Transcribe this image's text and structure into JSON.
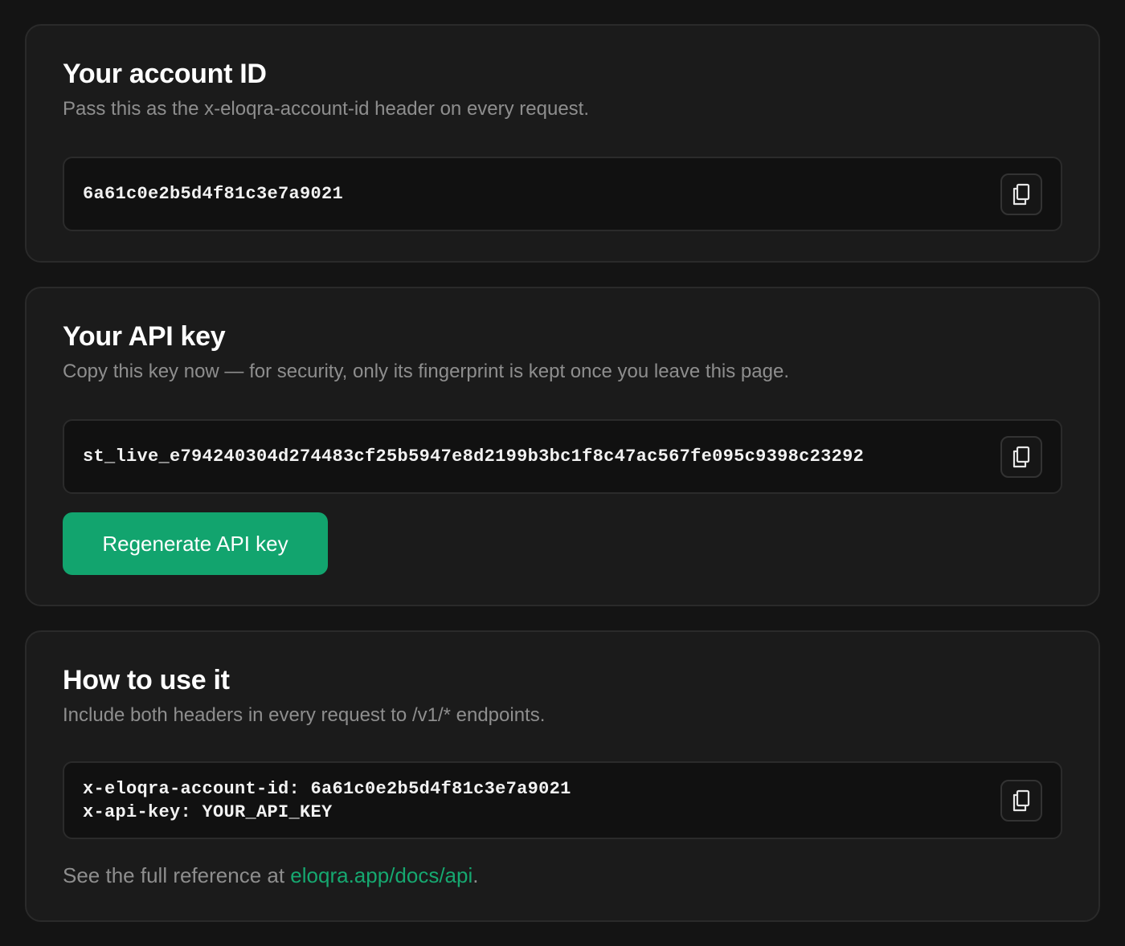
{
  "account_card": {
    "title": "Your account ID",
    "description": "Pass this as the x-eloqra-account-id header on every request.",
    "value": "6a61c0e2b5d4f81c3e7a9021"
  },
  "api_key_card": {
    "title": "Your API key",
    "description": "Copy this key now — for security, only its fingerprint is kept once you leave this page.",
    "value": "st_live_e794240304d274483cf25b5947e8d2199b3bc1f8c47ac567fe095c9398c23292",
    "regenerate_label": "Regenerate API key"
  },
  "usage_card": {
    "title": "How to use it",
    "description": "Include both headers in every request to /v1/* endpoints.",
    "headers_line1": "x-eloqra-account-id: 6a61c0e2b5d4f81c3e7a9021",
    "headers_line2": "x-api-key: YOUR_API_KEY",
    "reference_prefix": "See the full reference at ",
    "reference_link": "eloqra.app/docs/api",
    "reference_suffix": "."
  },
  "icons": {
    "copy": "copy-icon"
  },
  "colors": {
    "accent": "#12a46e",
    "link": "#16a870",
    "background": "#141414",
    "card": "#1b1b1b"
  }
}
